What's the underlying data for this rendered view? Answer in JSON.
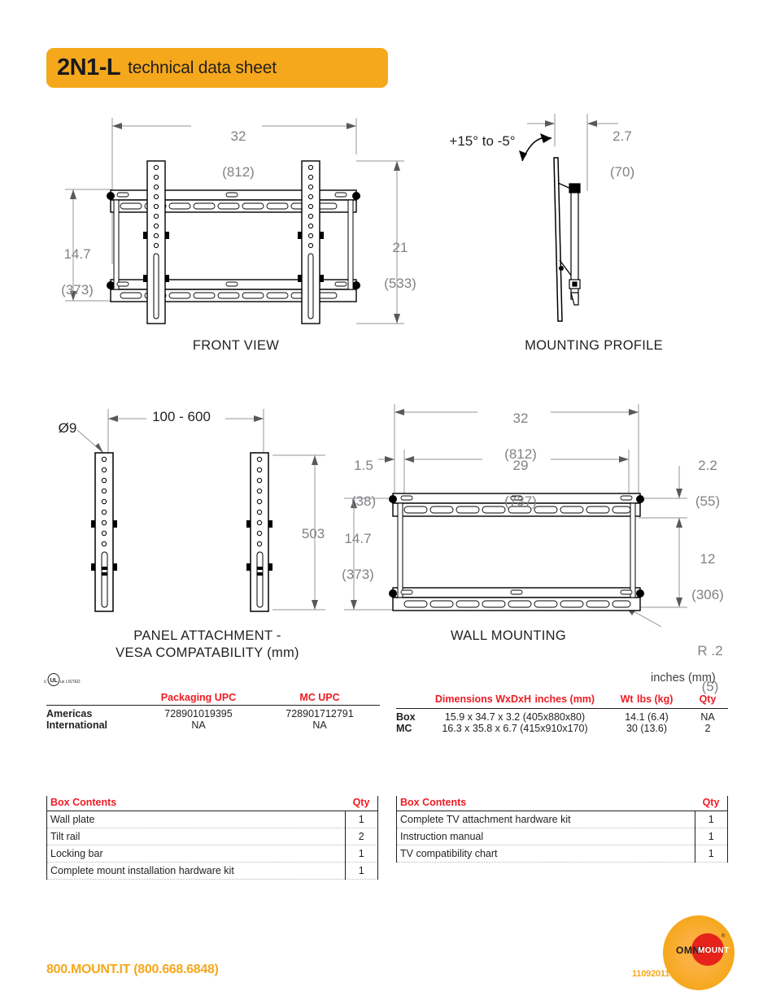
{
  "header": {
    "model": "2N1-L",
    "subtitle": "technical data sheet",
    "banner_color": "#F5A81C"
  },
  "drawings": {
    "front_view": {
      "caption": "FRONT VIEW",
      "dims": {
        "width_in": "32",
        "width_mm": "(812)",
        "height_left_in": "14.7",
        "height_left_mm": "(373)",
        "height_right_in": "21",
        "height_right_mm": "(533)"
      }
    },
    "mounting_profile": {
      "caption": "MOUNTING PROFILE",
      "dims": {
        "tilt_range": "+15° to -5°",
        "depth_in": "2.7",
        "depth_mm": "(70)"
      }
    },
    "panel_attachment": {
      "caption": "PANEL ATTACHMENT -\nVESA COMPATABILITY (mm)",
      "dims": {
        "hole_dia": "Ø9",
        "vesa_width": "100 - 600",
        "vesa_height": "503"
      }
    },
    "wall_mounting": {
      "caption": "WALL MOUNTING",
      "dims": {
        "width_in": "32",
        "width_mm": "(812)",
        "inner_width_in": "29",
        "inner_width_mm": "(737)",
        "offset_in": "1.5",
        "offset_mm": "(38)",
        "height_in": "14.7",
        "height_mm": "(373)",
        "top_in": "2.2",
        "top_mm": "(55)",
        "mid_in": "12",
        "mid_mm": "(306)",
        "radius_in": "R .2",
        "radius_mm": "(5)"
      }
    }
  },
  "certification": {
    "mark": "c(UL)us LISTED"
  },
  "units_note": "inches (mm)",
  "upc_table": {
    "columns": [
      "",
      "Packaging UPC",
      "MC UPC"
    ],
    "rows": [
      {
        "region": "Americas",
        "packaging_upc": "728901019395",
        "mc_upc": "728901712791"
      },
      {
        "region": "International",
        "packaging_upc": "NA",
        "mc_upc": "NA"
      }
    ]
  },
  "dimensions_table": {
    "columns": [
      "",
      "Dimensions WxDxH",
      "inches (mm)",
      "Wt",
      "lbs (kg)",
      "Qty"
    ],
    "header_dimensions_bold": "Dimensions WxDxH",
    "header_dimensions_light": "inches (mm)",
    "header_wt_bold": "Wt",
    "header_wt_light": "lbs (kg)",
    "header_qty": "Qty",
    "rows": [
      {
        "label": "Box",
        "dimensions": "15.9 x 34.7 x 3.2 (405x880x80)",
        "weight": "14.1 (6.4)",
        "qty": "NA"
      },
      {
        "label": "MC",
        "dimensions": "16.3 x 35.8 x 6.7 (415x910x170)",
        "weight": "30 (13.6)",
        "qty": "2"
      }
    ]
  },
  "box_contents_left": {
    "header": "Box Contents",
    "qty_header": "Qty",
    "rows": [
      {
        "item": "Wall plate",
        "qty": "1"
      },
      {
        "item": "Tilt rail",
        "qty": "2"
      },
      {
        "item": "Locking bar",
        "qty": "1"
      },
      {
        "item": "Complete mount installation hardware kit",
        "qty": "1"
      }
    ]
  },
  "box_contents_right": {
    "header": "Box Contents",
    "qty_header": "Qty",
    "rows": [
      {
        "item": "Complete TV attachment hardware kit",
        "qty": "1"
      },
      {
        "item": "Instruction manual",
        "qty": "1"
      },
      {
        "item": "TV compatibility chart",
        "qty": "1"
      }
    ]
  },
  "footer": {
    "phone": "800.MOUNT.IT (800.668.6848)",
    "doc_number": "11092011",
    "logo_text_omni": "OMNI",
    "logo_text_mount": "MOUNT",
    "logo_outer_color": "#F5A81C",
    "logo_inner_color": "#E5231B"
  }
}
